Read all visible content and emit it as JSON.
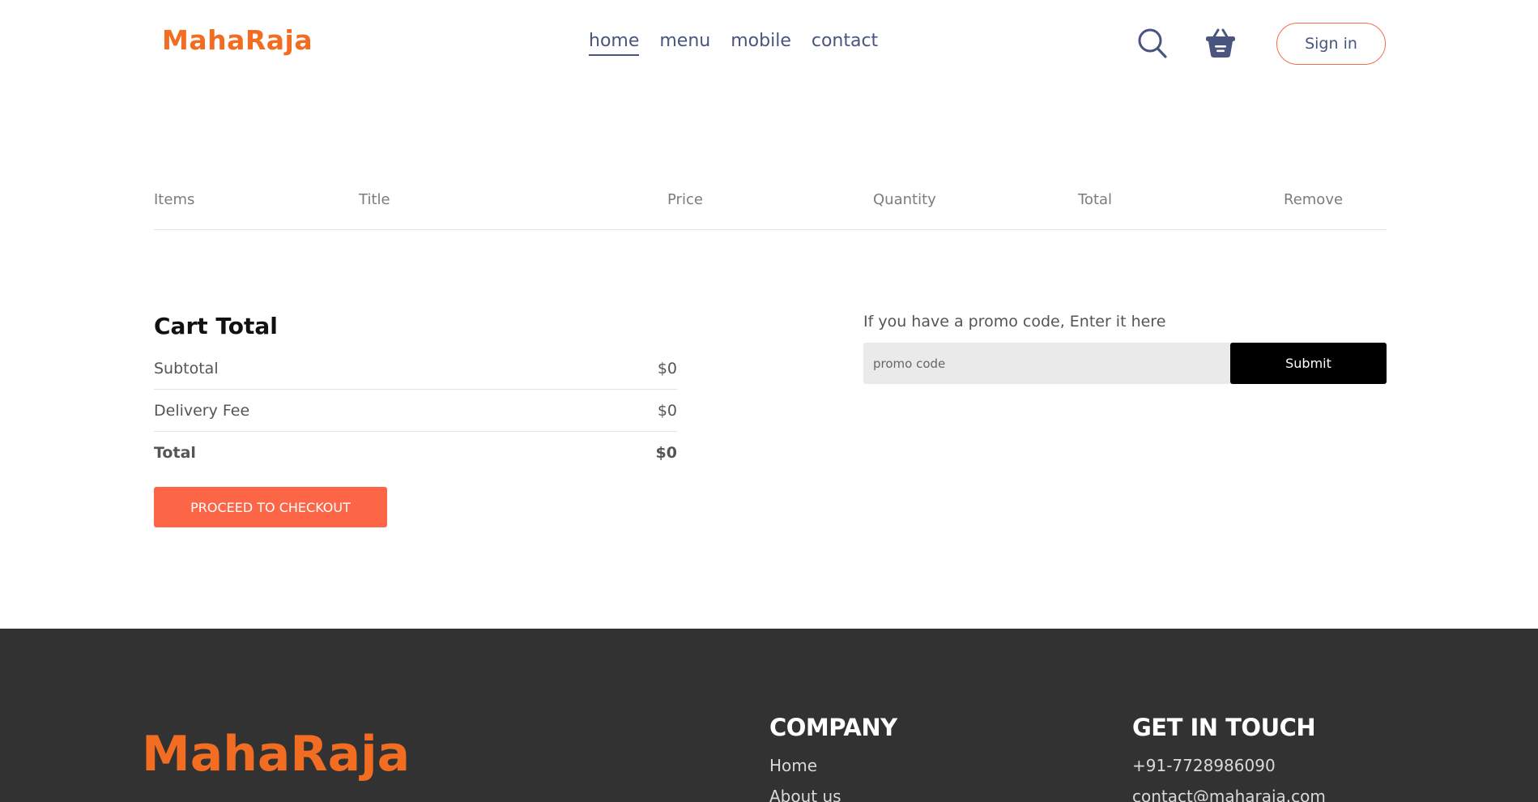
{
  "brand": {
    "name": "MahaRaja",
    "color": "#f26d21"
  },
  "nav": {
    "items": [
      {
        "label": "home",
        "active": true
      },
      {
        "label": "menu"
      },
      {
        "label": "mobile"
      },
      {
        "label": "contact"
      }
    ],
    "sign_in": "Sign in",
    "icons": [
      "search-icon",
      "basket-icon"
    ]
  },
  "cart": {
    "columns": [
      "Items",
      "Title",
      "Price",
      "Quantity",
      "Total",
      "Remove"
    ]
  },
  "cart_total": {
    "title": "Cart Total",
    "subtotal_label": "Subtotal",
    "subtotal_value": "$0",
    "delivery_label": "Delivery Fee",
    "delivery_value": "$0",
    "total_label": "Total",
    "total_value": "$0",
    "checkout_label": "PROCEED TO CHECKOUT",
    "checkout_color": "#fd6547"
  },
  "promo": {
    "label": "If you have a promo code, Enter it here",
    "placeholder": "promo code",
    "submit_label": "Submit"
  },
  "footer": {
    "company_title": "COMPANY",
    "company_links": [
      "Home",
      "About us"
    ],
    "touch_title": "GET IN TOUCH",
    "touch_items": [
      "+91-7728986090",
      "contact@maharaja.com"
    ]
  }
}
